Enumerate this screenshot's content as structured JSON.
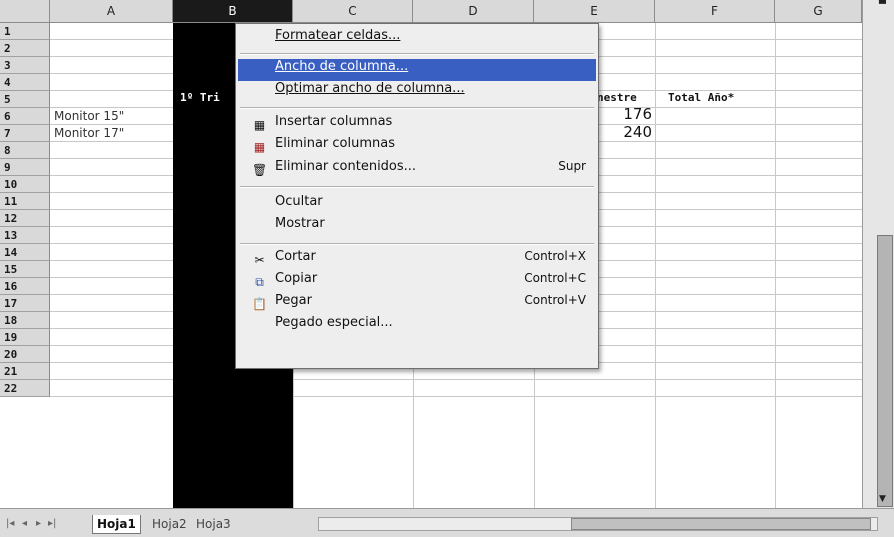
{
  "columns": [
    "A",
    "B",
    "C",
    "D",
    "E",
    "F",
    "G"
  ],
  "rows": [
    "1",
    "2",
    "3",
    "4",
    "5",
    "6",
    "7",
    "8",
    "9",
    "10",
    "11",
    "12",
    "13",
    "14",
    "15",
    "16",
    "17",
    "18",
    "19",
    "20",
    "21",
    "22"
  ],
  "cells": {
    "a4": "Monitor 15\"",
    "a5": "Monitor 17\"",
    "b3": "1º Tri",
    "e3": "nestre",
    "f3": "Total Año*",
    "e4": "176",
    "e5": "240"
  },
  "context_menu": {
    "items": [
      {
        "label": "Formatear celdas...",
        "shortcut": ""
      },
      {
        "label": "Ancho de columna...",
        "shortcut": ""
      },
      {
        "label": "Optimar ancho de columna...",
        "shortcut": ""
      },
      {
        "label": "Insertar columnas",
        "shortcut": ""
      },
      {
        "label": "Eliminar columnas",
        "shortcut": ""
      },
      {
        "label": "Eliminar contenidos...",
        "shortcut": "Supr"
      },
      {
        "label": "Ocultar",
        "shortcut": ""
      },
      {
        "label": "Mostrar",
        "shortcut": ""
      },
      {
        "label": "Cortar",
        "shortcut": "Control+X"
      },
      {
        "label": "Copiar",
        "shortcut": "Control+C"
      },
      {
        "label": "Pegar",
        "shortcut": "Control+V"
      },
      {
        "label": "Pegado especial...",
        "shortcut": ""
      }
    ],
    "highlight_color": "#3a5fc2"
  },
  "sheet_tabs": [
    "Hoja1",
    "Hoja2",
    "Hoja3"
  ],
  "active_tab": "Hoja1",
  "selection_color": "#000000"
}
